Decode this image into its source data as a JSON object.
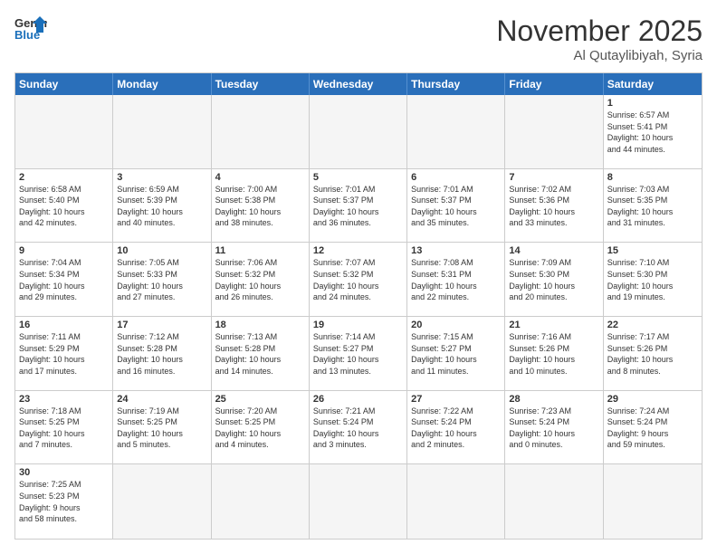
{
  "header": {
    "logo_line1": "General",
    "logo_line2": "Blue",
    "month": "November 2025",
    "location": "Al Qutaylibiyah, Syria"
  },
  "weekdays": [
    "Sunday",
    "Monday",
    "Tuesday",
    "Wednesday",
    "Thursday",
    "Friday",
    "Saturday"
  ],
  "rows": [
    [
      {
        "day": "",
        "info": ""
      },
      {
        "day": "",
        "info": ""
      },
      {
        "day": "",
        "info": ""
      },
      {
        "day": "",
        "info": ""
      },
      {
        "day": "",
        "info": ""
      },
      {
        "day": "",
        "info": ""
      },
      {
        "day": "1",
        "info": "Sunrise: 6:57 AM\nSunset: 5:41 PM\nDaylight: 10 hours\nand 44 minutes."
      }
    ],
    [
      {
        "day": "2",
        "info": "Sunrise: 6:58 AM\nSunset: 5:40 PM\nDaylight: 10 hours\nand 42 minutes."
      },
      {
        "day": "3",
        "info": "Sunrise: 6:59 AM\nSunset: 5:39 PM\nDaylight: 10 hours\nand 40 minutes."
      },
      {
        "day": "4",
        "info": "Sunrise: 7:00 AM\nSunset: 5:38 PM\nDaylight: 10 hours\nand 38 minutes."
      },
      {
        "day": "5",
        "info": "Sunrise: 7:01 AM\nSunset: 5:37 PM\nDaylight: 10 hours\nand 36 minutes."
      },
      {
        "day": "6",
        "info": "Sunrise: 7:01 AM\nSunset: 5:37 PM\nDaylight: 10 hours\nand 35 minutes."
      },
      {
        "day": "7",
        "info": "Sunrise: 7:02 AM\nSunset: 5:36 PM\nDaylight: 10 hours\nand 33 minutes."
      },
      {
        "day": "8",
        "info": "Sunrise: 7:03 AM\nSunset: 5:35 PM\nDaylight: 10 hours\nand 31 minutes."
      }
    ],
    [
      {
        "day": "9",
        "info": "Sunrise: 7:04 AM\nSunset: 5:34 PM\nDaylight: 10 hours\nand 29 minutes."
      },
      {
        "day": "10",
        "info": "Sunrise: 7:05 AM\nSunset: 5:33 PM\nDaylight: 10 hours\nand 27 minutes."
      },
      {
        "day": "11",
        "info": "Sunrise: 7:06 AM\nSunset: 5:32 PM\nDaylight: 10 hours\nand 26 minutes."
      },
      {
        "day": "12",
        "info": "Sunrise: 7:07 AM\nSunset: 5:32 PM\nDaylight: 10 hours\nand 24 minutes."
      },
      {
        "day": "13",
        "info": "Sunrise: 7:08 AM\nSunset: 5:31 PM\nDaylight: 10 hours\nand 22 minutes."
      },
      {
        "day": "14",
        "info": "Sunrise: 7:09 AM\nSunset: 5:30 PM\nDaylight: 10 hours\nand 20 minutes."
      },
      {
        "day": "15",
        "info": "Sunrise: 7:10 AM\nSunset: 5:30 PM\nDaylight: 10 hours\nand 19 minutes."
      }
    ],
    [
      {
        "day": "16",
        "info": "Sunrise: 7:11 AM\nSunset: 5:29 PM\nDaylight: 10 hours\nand 17 minutes."
      },
      {
        "day": "17",
        "info": "Sunrise: 7:12 AM\nSunset: 5:28 PM\nDaylight: 10 hours\nand 16 minutes."
      },
      {
        "day": "18",
        "info": "Sunrise: 7:13 AM\nSunset: 5:28 PM\nDaylight: 10 hours\nand 14 minutes."
      },
      {
        "day": "19",
        "info": "Sunrise: 7:14 AM\nSunset: 5:27 PM\nDaylight: 10 hours\nand 13 minutes."
      },
      {
        "day": "20",
        "info": "Sunrise: 7:15 AM\nSunset: 5:27 PM\nDaylight: 10 hours\nand 11 minutes."
      },
      {
        "day": "21",
        "info": "Sunrise: 7:16 AM\nSunset: 5:26 PM\nDaylight: 10 hours\nand 10 minutes."
      },
      {
        "day": "22",
        "info": "Sunrise: 7:17 AM\nSunset: 5:26 PM\nDaylight: 10 hours\nand 8 minutes."
      }
    ],
    [
      {
        "day": "23",
        "info": "Sunrise: 7:18 AM\nSunset: 5:25 PM\nDaylight: 10 hours\nand 7 minutes."
      },
      {
        "day": "24",
        "info": "Sunrise: 7:19 AM\nSunset: 5:25 PM\nDaylight: 10 hours\nand 5 minutes."
      },
      {
        "day": "25",
        "info": "Sunrise: 7:20 AM\nSunset: 5:25 PM\nDaylight: 10 hours\nand 4 minutes."
      },
      {
        "day": "26",
        "info": "Sunrise: 7:21 AM\nSunset: 5:24 PM\nDaylight: 10 hours\nand 3 minutes."
      },
      {
        "day": "27",
        "info": "Sunrise: 7:22 AM\nSunset: 5:24 PM\nDaylight: 10 hours\nand 2 minutes."
      },
      {
        "day": "28",
        "info": "Sunrise: 7:23 AM\nSunset: 5:24 PM\nDaylight: 10 hours\nand 0 minutes."
      },
      {
        "day": "29",
        "info": "Sunrise: 7:24 AM\nSunset: 5:24 PM\nDaylight: 9 hours\nand 59 minutes."
      }
    ],
    [
      {
        "day": "30",
        "info": "Sunrise: 7:25 AM\nSunset: 5:23 PM\nDaylight: 9 hours\nand 58 minutes."
      },
      {
        "day": "",
        "info": ""
      },
      {
        "day": "",
        "info": ""
      },
      {
        "day": "",
        "info": ""
      },
      {
        "day": "",
        "info": ""
      },
      {
        "day": "",
        "info": ""
      },
      {
        "day": "",
        "info": ""
      }
    ]
  ]
}
